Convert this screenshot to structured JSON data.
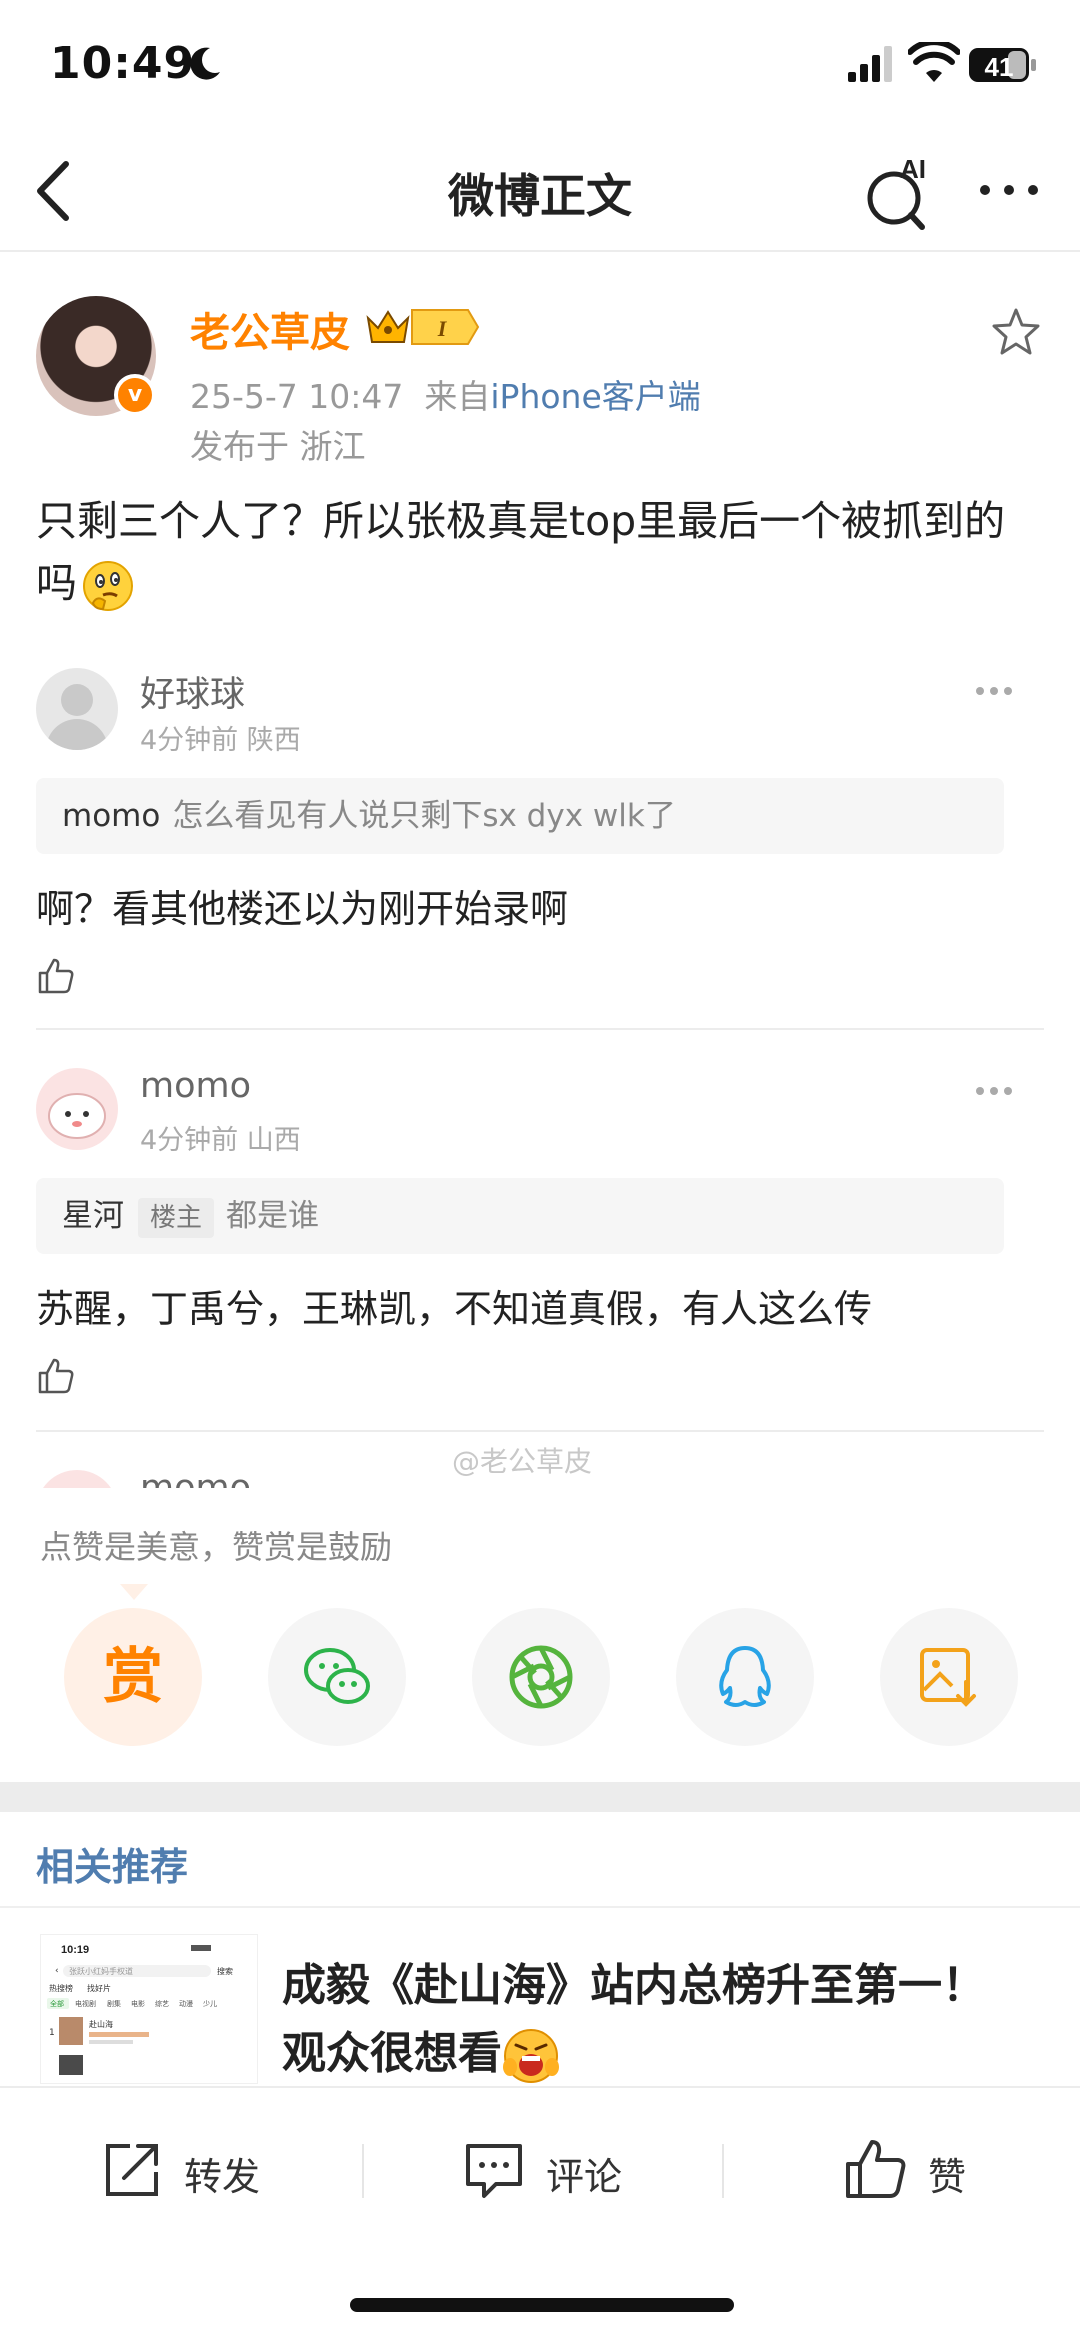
{
  "status_bar": {
    "time": "10:49",
    "battery": "41"
  },
  "nav": {
    "title": "微博正文",
    "ai_label": "AI"
  },
  "post": {
    "author": "老公草皮",
    "badge_level": "I",
    "verified_mark": "v",
    "date": "25-5-7 10:47",
    "source_prefix": "来自",
    "source": "iPhone客户端",
    "location": "发布于 浙江",
    "text": "只剩三个人了？所以张极真是top里最后一个被抓到的吗"
  },
  "comments": [
    {
      "name": "好球球",
      "meta": "4分钟前 陕西",
      "quote_user": "momo",
      "quote_tag": "",
      "quote_text": "怎么看见有人说只剩下sx dyx wlk了",
      "text": "啊？看其他楼还以为刚开始录啊"
    },
    {
      "name": "momo",
      "meta": "4分钟前 山西",
      "quote_user": "星河",
      "quote_tag": "楼主",
      "quote_text": "都是谁",
      "text": "苏醒，丁禹兮，王琳凯，不知道真假，有人这么传"
    },
    {
      "name": "momo"
    }
  ],
  "watermark": "@老公草皮",
  "share_sheet": {
    "title": "点赞是美意，赞赏是鼓励",
    "reward_label": "赏",
    "icons": [
      "wechat-icon",
      "moments-icon",
      "qq-icon",
      "save-image-icon"
    ]
  },
  "related": {
    "title": "相关推荐",
    "item_text": "成毅《赴山海》站内总榜升至第一！观众很想看",
    "thumb": {
      "time": "10:19",
      "search_hint": "张跃小红妈手权道",
      "search_btn": "搜索",
      "tabs": [
        "热搜榜",
        "找好片"
      ],
      "chips": [
        "全部",
        "电视剧",
        "剧集",
        "电影",
        "综艺",
        "动漫",
        "少儿"
      ],
      "row_title": "赴山海",
      "row_rank": "1"
    }
  },
  "bottom_bar": {
    "repost": "转发",
    "comment": "评论",
    "like": "赞"
  },
  "colors": {
    "accent": "#ff8200",
    "link": "#507daf"
  }
}
